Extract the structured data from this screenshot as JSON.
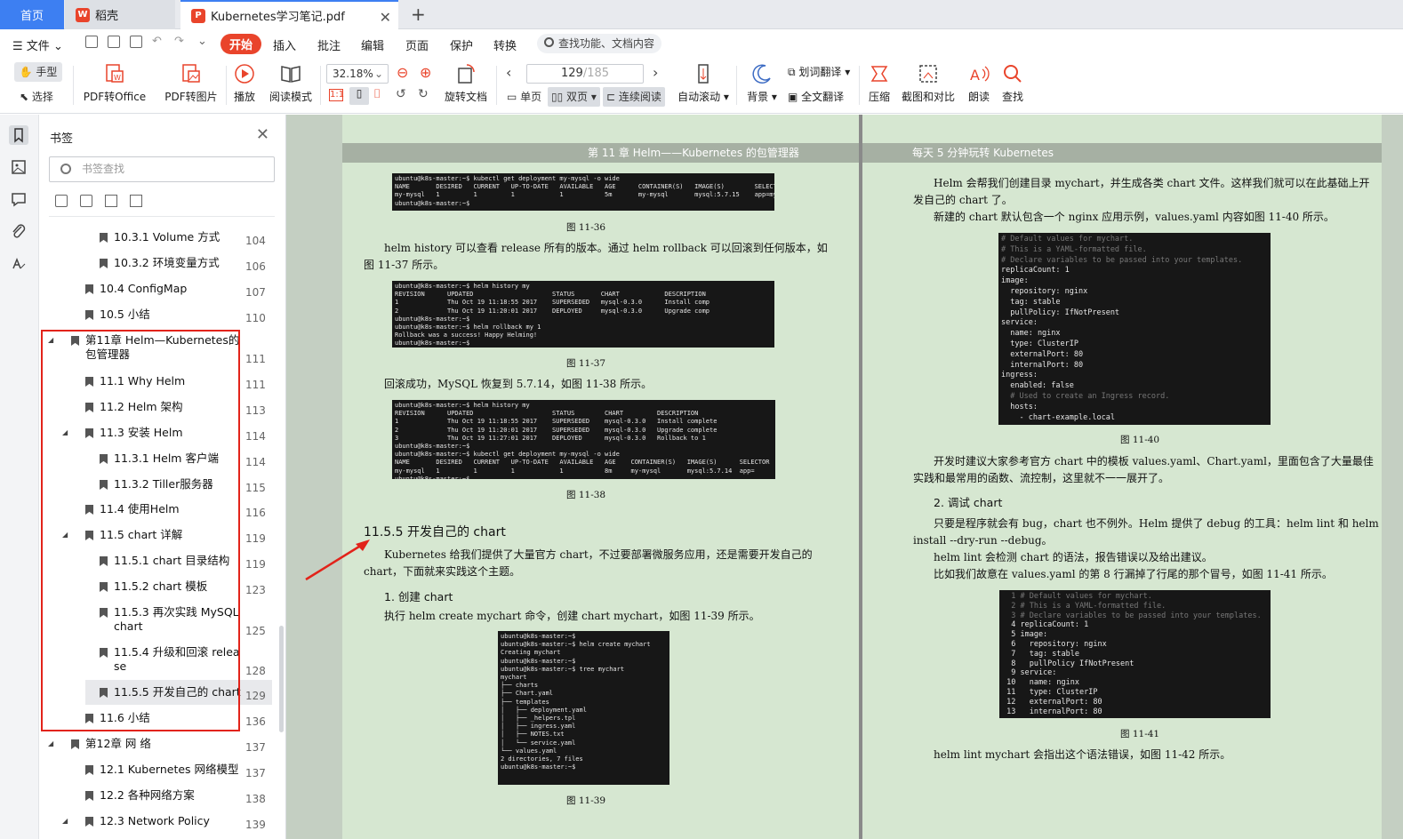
{
  "tabs": {
    "home": "首页",
    "daoke": "稻壳",
    "document": "Kubernetes学习笔记.pdf"
  },
  "menu": {
    "file": "文件",
    "items": [
      "开始",
      "插入",
      "批注",
      "编辑",
      "页面",
      "保护",
      "转换"
    ],
    "search": "查找功能、文档内容"
  },
  "toolbar": {
    "hand": "手型",
    "select": "选择",
    "pdf_office": "PDF转Office",
    "pdf_image": "PDF转图片",
    "play": "播放",
    "read_mode": "阅读模式",
    "zoom": "32.18%",
    "rotate": "旋转文档",
    "page_current": "129",
    "page_total": "/185",
    "single": "单页",
    "double": "双页",
    "continuous": "连续阅读",
    "autoscroll": "自动滚动",
    "background": "背景",
    "word_translate": "划词翻译",
    "full_translate": "全文翻译",
    "compress": "压缩",
    "screenshot": "截图和对比",
    "read_aloud": "朗读",
    "find": "查找"
  },
  "bookmarks": {
    "title": "书签",
    "search_placeholder": "书签查找",
    "items": [
      {
        "label": "10.3.1 Volume 方式",
        "page": "104"
      },
      {
        "label": "10.3.2 环境变量方式",
        "page": "106"
      },
      {
        "label": "10.4 ConfigMap",
        "page": "107"
      },
      {
        "label": "10.5 小结",
        "page": "110"
      },
      {
        "label": "第11章 Helm—Kubernetes的",
        "label2": "包管理器",
        "page": "111"
      },
      {
        "label": "11.1 Why Helm",
        "page": "111"
      },
      {
        "label": "11.2 Helm 架构",
        "page": "113"
      },
      {
        "label": "11.3 安装 Helm",
        "page": "114"
      },
      {
        "label": "11.3.1 Helm 客户端",
        "page": "114"
      },
      {
        "label": "11.3.2 Tiller服务器",
        "page": "115"
      },
      {
        "label": "11.4 使用Helm",
        "page": "116"
      },
      {
        "label": "11.5 chart 详解",
        "page": "119"
      },
      {
        "label": "11.5.1 chart 目录结构",
        "page": "119"
      },
      {
        "label": "11.5.2 chart 模板",
        "page": "123"
      },
      {
        "label": "11.5.3 再次实践 MySQL",
        "label2": "chart",
        "page": "125"
      },
      {
        "label": "11.5.4 升级和回滚 relea",
        "label2": "se",
        "page": "128"
      },
      {
        "label": "11.5.5 开发自己的 chart",
        "page": "129"
      },
      {
        "label": "11.6 小结",
        "page": "136"
      },
      {
        "label": "第12章 网 络",
        "page": "137"
      },
      {
        "label": "12.1 Kubernetes 网络模型",
        "page": "137"
      },
      {
        "label": "12.2 各种网络方案",
        "page": "138"
      },
      {
        "label": "12.3 Network Policy",
        "page": "139"
      }
    ]
  },
  "left_page": {
    "header": "第 11 章   Helm——Kubernetes 的包管理器",
    "term1": [
      "ubuntu@k8s-master:~$ kubectl get deployment my-mysql -o wide",
      "NAME       DESIRED   CURRENT   UP-TO-DATE   AVAILABLE   AGE      CONTAINER(S)   IMAGE(S)        SELECTOR",
      "my-mysql   1         1         1            1           5m       my-mysql       mysql:5.7.15    app=my",
      "ubuntu@k8s-master:~$"
    ],
    "cap1": "图 11-36",
    "para1": "helm history  可以查看  release  所有的版本。通过  helm rollback  可以回滚到任何版本，如",
    "para1b": "图 11-37 所示。",
    "term2": [
      "ubuntu@k8s-master:~$ helm history my",
      "REVISION      UPDATED                     STATUS       CHART            DESCRIPTION",
      "1             Thu Oct 19 11:18:55 2017    SUPERSEDED   mysql-0.3.0      Install comp",
      "2             Thu Oct 19 11:20:01 2017    DEPLOYED     mysql-0.3.0      Upgrade comp",
      "ubuntu@k8s-master:~$",
      "ubuntu@k8s-master:~$ helm rollback my 1",
      "Rollback was a success! Happy Helming!",
      "ubuntu@k8s-master:~$"
    ],
    "cap2": "图 11-37",
    "para2": "回滚成功，MySQL  恢复到  5.7.14，如图 11-38 所示。",
    "term3": [
      "ubuntu@k8s-master:~$ helm history my",
      "REVISION      UPDATED                     STATUS        CHART         DESCRIPTION",
      "1             Thu Oct 19 11:18:55 2017    SUPERSEDED    mysql-0.3.0   Install complete",
      "2             Thu Oct 19 11:20:01 2017    SUPERSEDED    mysql-0.3.0   Upgrade complete",
      "3             Thu Oct 19 11:27:01 2017    DEPLOYED      mysql-0.3.0   Rollback to 1",
      "ubuntu@k8s-master:~$",
      "ubuntu@k8s-master:~$ kubectl get deployment my-mysql -o wide",
      "NAME       DESIRED   CURRENT   UP-TO-DATE   AVAILABLE   AGE    CONTAINER(S)   IMAGE(S)      SELECTOR",
      "my-mysql   1         1         1            1           8m     my-mysql       mysql:5.7.14  app=",
      "ubuntu@k8s-master:~$"
    ],
    "cap3": "图 11-38",
    "section": "11.5.5   开发自己的  chart",
    "para3": "Kubernetes  给我们提供了大量官方  chart，不过要部署微服务应用，还是需要开发自己的",
    "para3b": "chart，下面就来实践这个主题。",
    "sub1": "1. 创建  chart",
    "para4": "执行  helm create mychart  命令，创建  chart mychart，如图 11-39 所示。",
    "term4": [
      "ubuntu@k8s-master:~$",
      "ubuntu@k8s-master:~$ helm create mychart",
      "Creating mychart",
      "ubuntu@k8s-master:~$",
      "ubuntu@k8s-master:~$ tree mychart",
      "mychart",
      "├── charts",
      "├── Chart.yaml",
      "├── templates",
      "│   ├── deployment.yaml",
      "│   ├── _helpers.tpl",
      "│   ├── ingress.yaml",
      "│   ├── NOTES.txt",
      "│   └── service.yaml",
      "└── values.yaml",
      "",
      "2 directories, 7 files",
      "ubuntu@k8s-master:~$"
    ],
    "cap4": "图 11-39"
  },
  "right_page": {
    "header": "每天 5 分钟玩转  Kubernetes",
    "para1": "Helm  会帮我们创建目录  mychart，并生成各类  chart 文件。这样我们就可以在此基础上开",
    "para1b": "发自己的  chart  了。",
    "para2": "新建的  chart  默认包含一个  nginx  应用示例，values.yaml  内容如图 11-40 所示。",
    "term1": [
      "# Default values for mychart.",
      "# This is a YAML-formatted file.",
      "# Declare variables to be passed into your templates.",
      "replicaCount: 1",
      "image:",
      "  repository: nginx",
      "  tag: stable",
      "  pullPolicy: IfNotPresent",
      "service:",
      "  name: nginx",
      "  type: ClusterIP",
      "  externalPort: 80",
      "  internalPort: 80",
      "ingress:",
      "  enabled: false",
      "  # Used to create an Ingress record.",
      "  hosts:",
      "    - chart-example.local"
    ],
    "cap1": "图 11-40",
    "para3": "开发时建议大家参考官方  chart  中的模板 values.yaml、Chart.yaml，里面包含了大量最佳",
    "para3b": "实践和最常用的函数、流控制，这里就不一一展开了。",
    "sub1": "2. 调试  chart",
    "para4": "只要是程序就会有  bug，chart  也不例外。Helm  提供了  debug  的工具：helm lint  和  helm",
    "para4b": "install --dry-run --debug。",
    "para5": "helm lint  会检测  chart  的语法，报告错误以及给出建议。",
    "para6": "比如我们故意在  values.yaml  的第  8  行漏掉了行尾的那个冒号，如图 11-41 所示。",
    "term2": [
      "  1 # Default values for mychart.",
      "  2 # This is a YAML-formatted file.",
      "  3 # Declare variables to be passed into your templates.",
      "  4 replicaCount: 1",
      "  5 image:",
      "  6   repository: nginx",
      "  7   tag: stable",
      "  8   pullPolicy IfNotPresent",
      "  9 service:",
      " 10   name: nginx",
      " 11   type: ClusterIP",
      " 12   externalPort: 80",
      " 13   internalPort: 80"
    ],
    "cap2": "图 11-41",
    "para7": "helm lint mychart  会指出这个语法错误，如图 11-42 所示。"
  }
}
